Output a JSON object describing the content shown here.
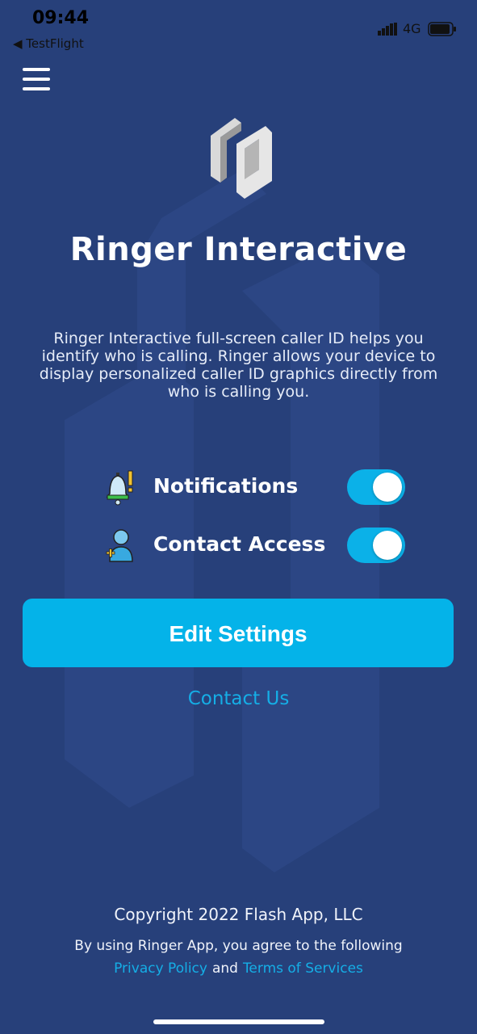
{
  "status_bar": {
    "time": "09:44",
    "back_app": "◀ TestFlight",
    "network": "4G"
  },
  "header": {
    "menu_icon": "hamburger-menu-icon",
    "logo_icon": "ringer-logo-icon",
    "title": "Ringer Interactive"
  },
  "main": {
    "description": "Ringer Interactive full-screen caller ID helps you identify who is calling. Ringer allows your device to display personalized caller ID graphics directly from who is calling you.",
    "permissions": [
      {
        "label": "Notifications",
        "icon": "bell-icon",
        "enabled": true
      },
      {
        "label": "Contact Access",
        "icon": "add-contact-icon",
        "enabled": true
      }
    ],
    "edit_settings_label": "Edit Settings",
    "contact_us_label": "Contact Us"
  },
  "footer": {
    "copyright": "Copyright 2022 Flash App, LLC",
    "agree_text": "By using Ringer App, you agree to the following",
    "privacy_label": "Privacy Policy",
    "and_text": "and",
    "terms_label": "Terms of Services"
  },
  "colors": {
    "background": "#27407a",
    "accent": "#04b3e9",
    "link": "#15aee6",
    "text": "#ffffff"
  }
}
